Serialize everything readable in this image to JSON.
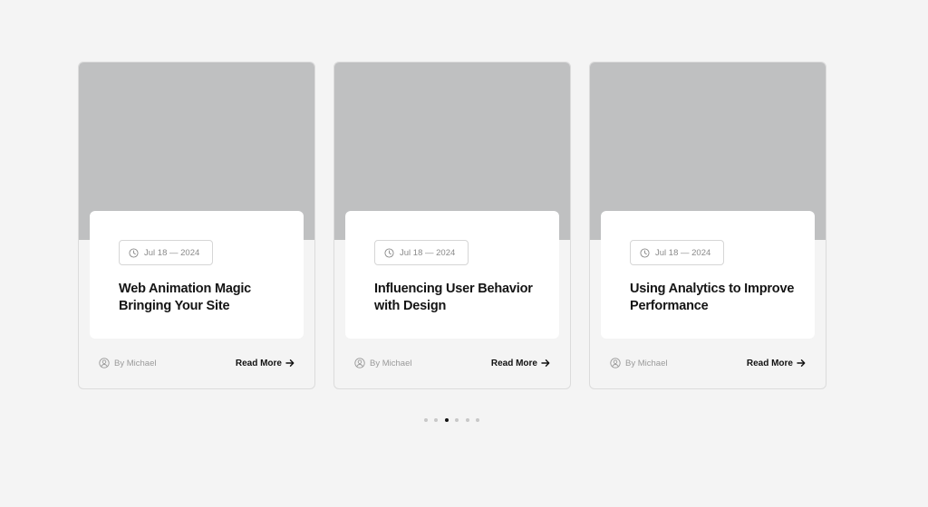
{
  "cards": [
    {
      "date": "Jul 18 — 2024",
      "title": "Web Animation Magic Bringing Your Site",
      "author": "By Michael",
      "read_more": "Read More"
    },
    {
      "date": "Jul 18 — 2024",
      "title": "Influencing User Behavior with Design",
      "author": "By Michael",
      "read_more": "Read More"
    },
    {
      "date": "Jul 18 — 2024",
      "title": "Using Analytics to Improve Performance",
      "author": "By Michael",
      "read_more": "Read More"
    }
  ],
  "pagination": {
    "total": 6,
    "active_index": 2
  },
  "colors": {
    "background": "#f4f4f4",
    "image_placeholder": "#bfc0c1",
    "active_dot": "#111111",
    "inactive_dot": "#c8c8c8"
  },
  "icons": {
    "date": "clock-icon",
    "author": "user-circle-icon",
    "read_more": "arrow-right-icon"
  }
}
